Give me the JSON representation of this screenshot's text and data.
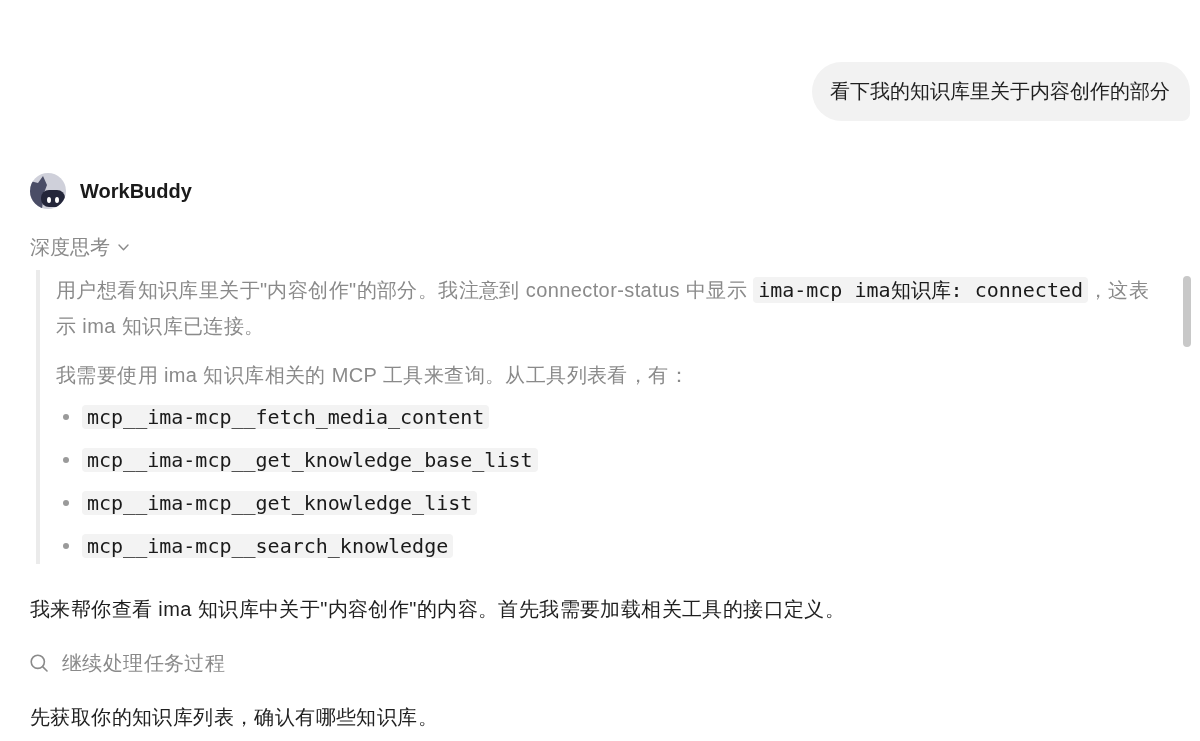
{
  "user_message": {
    "text": "看下我的知识库里关于内容创作的部分"
  },
  "assistant": {
    "name": "WorkBuddy"
  },
  "thinking": {
    "label": "深度思考",
    "expanded": true,
    "paragraphs": [
      {
        "segments": [
          {
            "kind": "text",
            "text": "用户想看知识库里关于\"内容创作\"的部分。我注意到 connector-status 中显示 "
          },
          {
            "kind": "code",
            "text": "ima-mcp ima知识库: connected"
          },
          {
            "kind": "text",
            "text": "，这表示 ima 知识库已连接。"
          }
        ]
      },
      {
        "segments": [
          {
            "kind": "text",
            "text": "我需要使用 ima 知识库相关的 MCP 工具来查询。从工具列表看，有："
          }
        ]
      }
    ],
    "tools": [
      "mcp__ima-mcp__fetch_media_content",
      "mcp__ima-mcp__get_knowledge_base_list",
      "mcp__ima-mcp__get_knowledge_list",
      "mcp__ima-mcp__search_knowledge"
    ]
  },
  "reply": [
    {
      "kind": "text",
      "text": "我来帮你查看 ima 知识库中关于\"内容创作\"的内容。首先我需要加载相关工具的接口定义。"
    },
    {
      "kind": "step",
      "text": "继续处理任务过程"
    },
    {
      "kind": "text",
      "text": "先获取你的知识库列表，确认有哪些知识库。"
    }
  ]
}
